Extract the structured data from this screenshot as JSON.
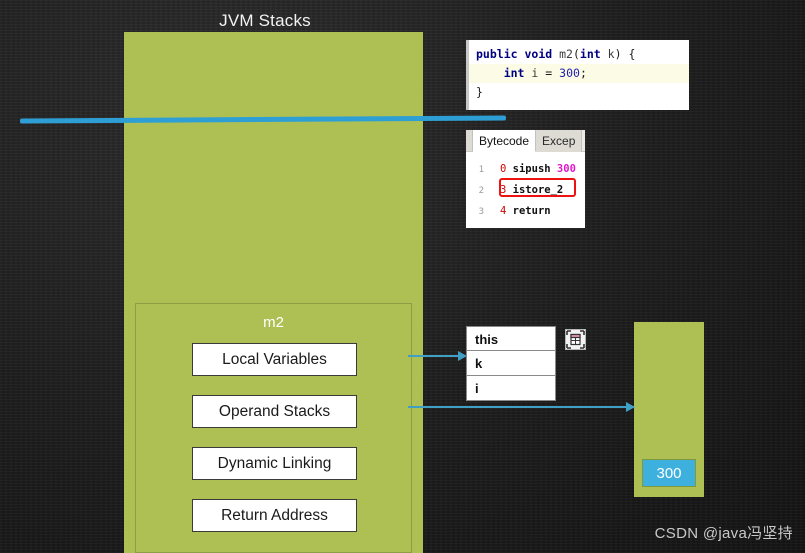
{
  "diagram": {
    "title": "JVM Stacks",
    "watermark": "CSDN @java冯坚持",
    "colors": {
      "stack_green": "#AEC053",
      "value_blue": "#3EB0DE",
      "arrow_blue": "#3F9FC4",
      "cut_line_blue": "#2E9FD4",
      "highlight_red": "#EE1111",
      "background": "#232323"
    }
  },
  "frame": {
    "name": "m2",
    "components": [
      {
        "label": "Local Variables"
      },
      {
        "label": "Operand Stacks"
      },
      {
        "label": "Dynamic Linking"
      },
      {
        "label": "Return Address"
      }
    ]
  },
  "code_panel": {
    "lines": [
      {
        "kw1": "public",
        "kw2": "void",
        "method": "m2",
        "paren_open": "(",
        "kw3": "int",
        "param": "k",
        "paren_close": ")",
        "brace": " {"
      },
      {
        "kw": "int",
        "var": "i",
        "eq": "=",
        "value": "300",
        "semi": ";"
      },
      {
        "brace": "}"
      }
    ],
    "highlighted_line_index": 1,
    "full_text": "public void m2(int k) {\n    int i = 300;\n}"
  },
  "bytecode_panel": {
    "tabs": [
      {
        "label": "Bytecode",
        "active": true
      },
      {
        "label": "Excep",
        "active": false
      }
    ],
    "instructions": [
      {
        "line": "1",
        "offset": "0",
        "op": "sipush",
        "arg": "300",
        "highlighted": false
      },
      {
        "line": "2",
        "offset": "3",
        "op": "istore_2",
        "arg": "",
        "highlighted": true
      },
      {
        "line": "3",
        "offset": "4",
        "op": "return",
        "arg": "",
        "highlighted": false
      }
    ]
  },
  "local_variables_table": {
    "rows": [
      {
        "name": "this"
      },
      {
        "name": "k"
      },
      {
        "name": "i"
      }
    ],
    "icon": "table-grid-icon"
  },
  "operand_stack": {
    "top_value": "300"
  }
}
